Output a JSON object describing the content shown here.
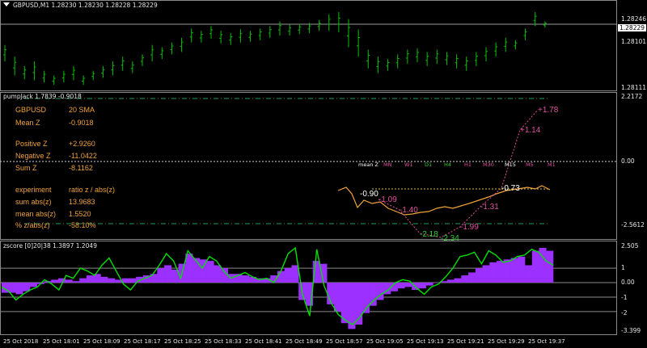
{
  "main_chart": {
    "header": "GBPUSD,M1  1.28230 1.28230 1.28228 1.28229",
    "last_price": "1.28229",
    "price_labels": [
      "1.28246",
      "1.28101",
      "1.28111"
    ],
    "candle_color": "#00c000",
    "highs": [
      1.28185,
      1.2816,
      1.2814,
      1.2815,
      1.2813,
      1.2812,
      1.2813,
      1.2814,
      1.2812,
      1.2813,
      1.2814,
      1.2815,
      1.2816,
      1.2815,
      1.28165,
      1.28185,
      1.2818,
      1.2819,
      1.282,
      1.2822,
      1.28215,
      1.28225,
      1.28215,
      1.2821,
      1.28218,
      1.28215,
      1.2822,
      1.28225,
      1.28235,
      1.28228,
      1.2823,
      1.28232,
      1.28238,
      1.2825,
      1.28255,
      1.2824,
      1.28218,
      1.28175,
      1.2816,
      1.28155,
      1.28165,
      1.28175,
      1.28178,
      1.2817,
      1.28175,
      1.2817,
      1.28165,
      1.2816,
      1.2817,
      1.2818,
      1.2819,
      1.282,
      1.28195,
      1.2822,
      1.28255,
      1.28235
    ],
    "lows": [
      1.2815,
      1.2812,
      1.28112,
      1.2811,
      1.28105,
      1.281,
      1.28105,
      1.2811,
      1.281,
      1.2811,
      1.28115,
      1.2812,
      1.2813,
      1.28125,
      1.2814,
      1.2815,
      1.28155,
      1.28165,
      1.2817,
      1.2819,
      1.2819,
      1.28198,
      1.28188,
      1.28185,
      1.2819,
      1.28192,
      1.28195,
      1.282,
      1.28205,
      1.28205,
      1.28208,
      1.2821,
      1.28215,
      1.28215,
      1.28212,
      1.2818,
      1.2816,
      1.28135,
      1.28125,
      1.2813,
      1.28135,
      1.28145,
      1.28148,
      1.2814,
      1.28145,
      1.28142,
      1.28135,
      1.2813,
      1.2814,
      1.2815,
      1.2816,
      1.2817,
      1.28175,
      1.28195,
      1.28225,
      1.28222
    ]
  },
  "pumpjack": {
    "header": "pumpJack 1.7839 -0.9018",
    "axis_labels": [
      "2.2172",
      "0.00",
      "-2.5612"
    ],
    "rows": [
      {
        "label": "GBPUSD",
        "value": "20 SMA"
      },
      {
        "label": "Mean Z",
        "value": "-0.9018"
      },
      {
        "label": "Positive Z",
        "value": "+2.9260"
      },
      {
        "label": "Negative Z",
        "value": "-11.0422"
      },
      {
        "label": "Sum Z",
        "value": "-8.1162"
      },
      {
        "label": "experiment",
        "value": "ratio z / abs(z)"
      },
      {
        "label": "sum abs(z)",
        "value": "13.9683"
      },
      {
        "label": "mean abs(z)",
        "value": "1.5520"
      },
      {
        "label": "% z/abs(z)",
        "value": "-58.10%"
      }
    ],
    "tf_labels": [
      "mean Z",
      "MN",
      "W1",
      "D1",
      "H4",
      "H1",
      "M30",
      "M15",
      "M5",
      "M1"
    ],
    "tf_values": [
      "-0.90",
      "-1.09",
      "-1.40",
      "-2.18",
      "-2.34",
      "-1.99",
      "-1.31",
      "-0.73",
      "+1.14",
      "+1.78"
    ],
    "tf_colors": [
      "#ffffff",
      "#e04fa0",
      "#2ed02e",
      "#2ed02e",
      "#2ed02e",
      "#e04fa0",
      "#e04fa0",
      "#ffffff",
      "#e04fa0",
      "#e04fa0"
    ],
    "text_color": "#f0a23a"
  },
  "zscore": {
    "header": "zscore [0]20|38 1.3897 1.2049",
    "axis_labels": [
      "2.505",
      "1",
      "0.00",
      "-1",
      "-2",
      "-3.399"
    ],
    "histogram_color": "#9b30ff",
    "line_color": "#00e000",
    "hist": [
      -0.7,
      -0.7,
      -0.8,
      -0.6,
      -0.3,
      -0.1,
      0.1,
      0.2,
      0.3,
      0.2,
      0.1,
      0.3,
      0.5,
      0.6,
      0.4,
      0.3,
      0.2,
      0.3,
      0.3,
      0.4,
      0.5,
      0.6,
      1.0,
      1.2,
      0.9,
      1.3,
      2.0,
      1.7,
      1.6,
      1.5,
      1.2,
      1.0,
      0.6,
      0.6,
      0.5,
      0.4,
      0.3,
      0.3,
      0.5,
      0.8,
      1.0,
      1.2,
      -1.2,
      -1.6,
      1.5,
      1.3,
      -1.5,
      -2.0,
      -2.8,
      -3.2,
      -2.9,
      -2.1,
      -1.6,
      -1.2,
      -0.8,
      -0.6,
      -0.4,
      -0.3,
      -0.5,
      -0.4,
      -0.2,
      0.0,
      0.1,
      0.2,
      0.3,
      0.5,
      0.7,
      1.0,
      1.2,
      1.4,
      1.5,
      1.6,
      1.7,
      1.8,
      1.2,
      2.2,
      2.4,
      2.2
    ],
    "line": [
      -0.3,
      -0.6,
      -1.2,
      -0.8,
      -0.5,
      -0.3,
      0.2,
      -0.1,
      -0.5,
      0.5,
      0.3,
      1.0,
      0.8,
      0.5,
      1.2,
      1.7,
      0.8,
      -0.1,
      -0.5,
      0.1,
      0.3,
      0.5,
      1.2,
      2.0,
      1.5,
      0.3,
      2.2,
      1.6,
      1.0,
      1.8,
      1.5,
      0.8,
      0.3,
      0.5,
      0.7,
      0.4,
      0.2,
      0.3,
      0.0,
      0.8,
      2.0,
      2.4,
      -0.8,
      -2.3,
      2.3,
      -0.2,
      -1.4,
      -2.2,
      -2.6,
      -2.9,
      -2.4,
      -1.7,
      -1.2,
      -0.8,
      -0.5,
      0.0,
      0.2,
      0.1,
      -0.4,
      -0.8,
      -0.3,
      -0.1,
      0.4,
      1.0,
      1.8,
      1.9,
      2.1,
      1.3,
      2.2,
      1.9,
      1.4,
      1.5,
      1.8,
      1.9,
      2.3,
      2.1,
      1.5,
      1.2
    ]
  },
  "time_axis": [
    "25 Oct 2018",
    "25 Oct 18:01",
    "25 Oct 18:09",
    "25 Oct 18:17",
    "25 Oct 18:25",
    "25 Oct 18:33",
    "25 Oct 18:41",
    "25 Oct 18:49",
    "25 Oct 18:57",
    "25 Oct 19:05",
    "25 Oct 19:13",
    "25 Oct 19:21",
    "25 Oct 19:29",
    "25 Oct 19:37"
  ]
}
